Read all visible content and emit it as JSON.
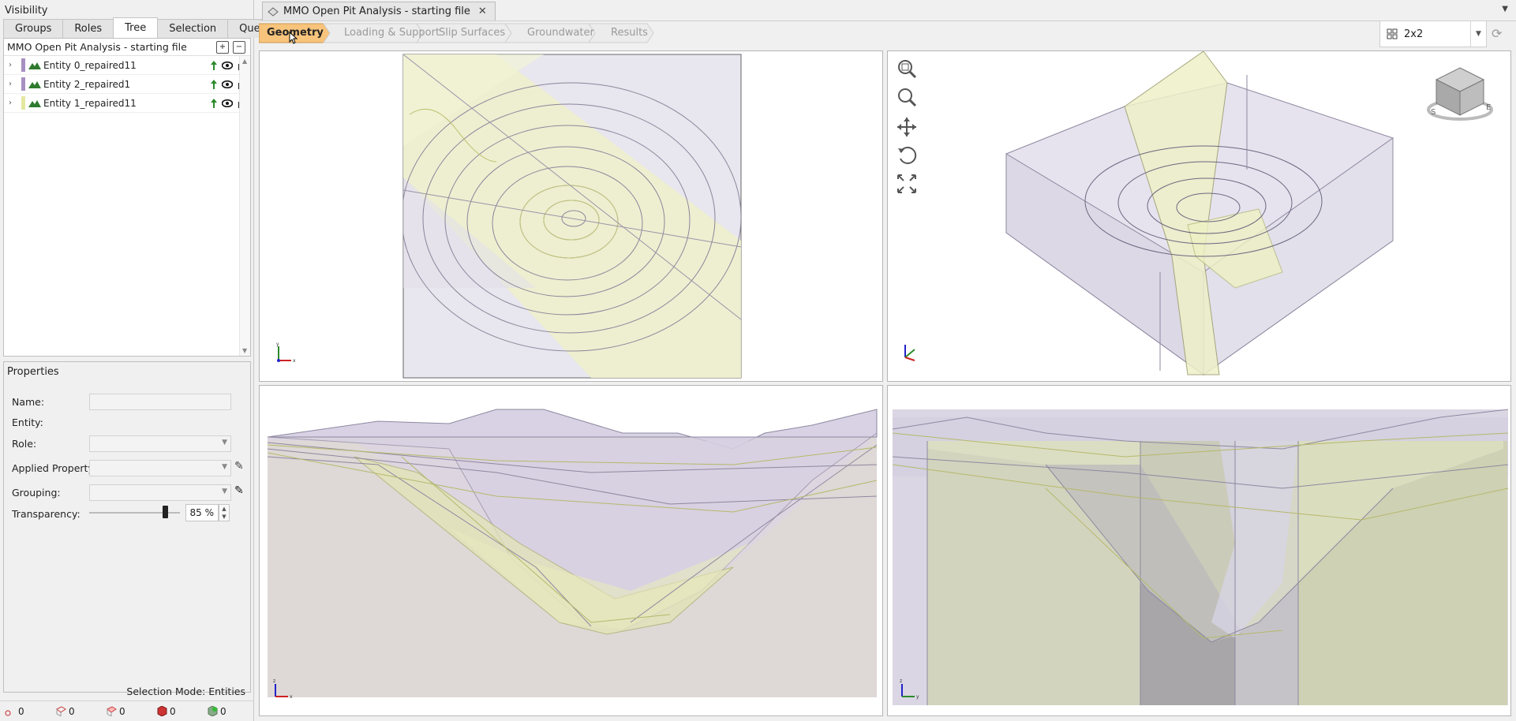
{
  "left_panel": {
    "visibility_title": "Visibility",
    "tabs": [
      "Groups",
      "Roles",
      "Tree",
      "Selection",
      "Query"
    ],
    "active_tab": "Tree",
    "tree_header": "MMO Open Pit Analysis - starting file",
    "entities": [
      {
        "label": "Entity 0_repaired11",
        "color": "#a78fc2"
      },
      {
        "label": "Entity 2_repaired1",
        "color": "#a78fc2"
      },
      {
        "label": "Entity 1_repaired11",
        "color": "#e3e8a0"
      }
    ]
  },
  "properties": {
    "title": "Properties",
    "name_label": "Name:",
    "entity_label": "Entity:",
    "role_label": "Role:",
    "applied_label": "Applied Property:",
    "grouping_label": "Grouping:",
    "transparency_label": "Transparency:",
    "transparency_value": "85 %",
    "transparency_level": 0.85
  },
  "selection_mode": "Selection Mode: Entities",
  "status_counts": [
    "0",
    "0",
    "0",
    "0",
    "0"
  ],
  "doc_tab": {
    "title": "MMO Open Pit Analysis - starting file"
  },
  "workflow": {
    "steps": [
      "Geometry",
      "Loading & Support",
      "Slip Surfaces",
      "Groundwater",
      "Results"
    ],
    "active": "Geometry"
  },
  "layout_select": "2x2",
  "colors": {
    "accent": "#f8c47c",
    "purple_material": "#a78fc2",
    "yellow_material": "#e3e8a0"
  },
  "icons": [
    "search-icon",
    "zoom-icon",
    "pan-icon",
    "rotate-icon",
    "fit-icon",
    "view-cube-icon",
    "refresh-icon",
    "eye-icon",
    "lock-icon"
  ]
}
